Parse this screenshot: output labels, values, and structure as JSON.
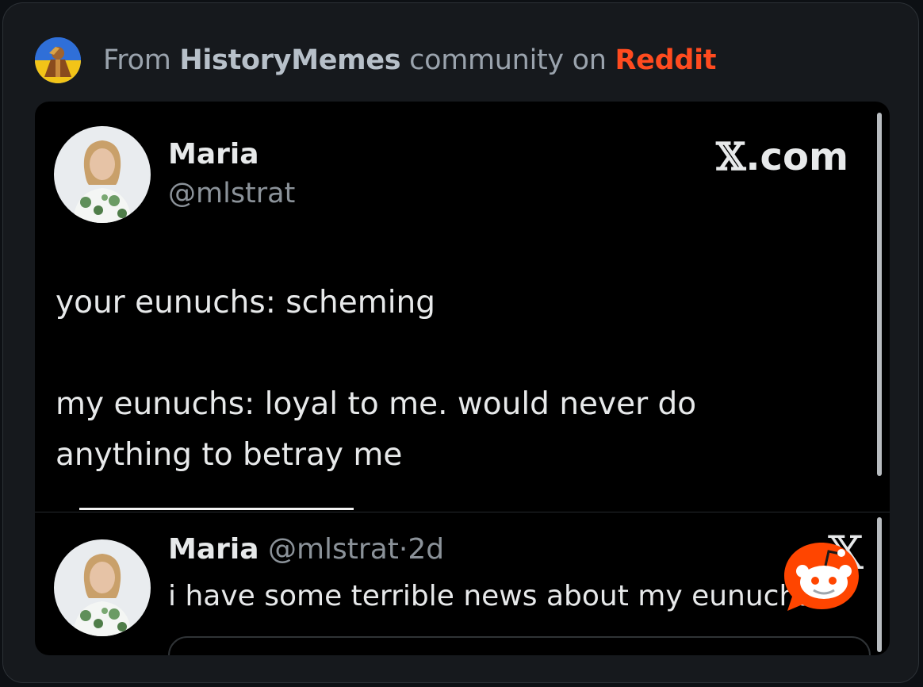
{
  "source": {
    "prefix": "From",
    "community": "HistoryMemes",
    "middle": "community on",
    "site": "Reddit",
    "community_icon": "history-memes-community-icon"
  },
  "tweet": {
    "author_name": "Maria",
    "author_handle": "@mlstrat",
    "brand": {
      "letter": "𝕏",
      "suffix": ".com"
    },
    "text": "your eunuchs: scheming\n\nmy eunuchs: loyal to me. would never do\nanything to betray me"
  },
  "quoted_tweet": {
    "author_name": "Maria",
    "author_handle": "@mlstrat",
    "time": "2d",
    "separator": "·",
    "text": "i have some terrible news about my eunuchs",
    "x_logo": "𝕏"
  },
  "colors": {
    "reddit_orange": "#ff4b1f",
    "background": "#16191d",
    "card": "#000000"
  },
  "icons": [
    "community-avatar-icon",
    "profile-avatar",
    "x-logo-icon",
    "reddit-snoo-icon"
  ]
}
